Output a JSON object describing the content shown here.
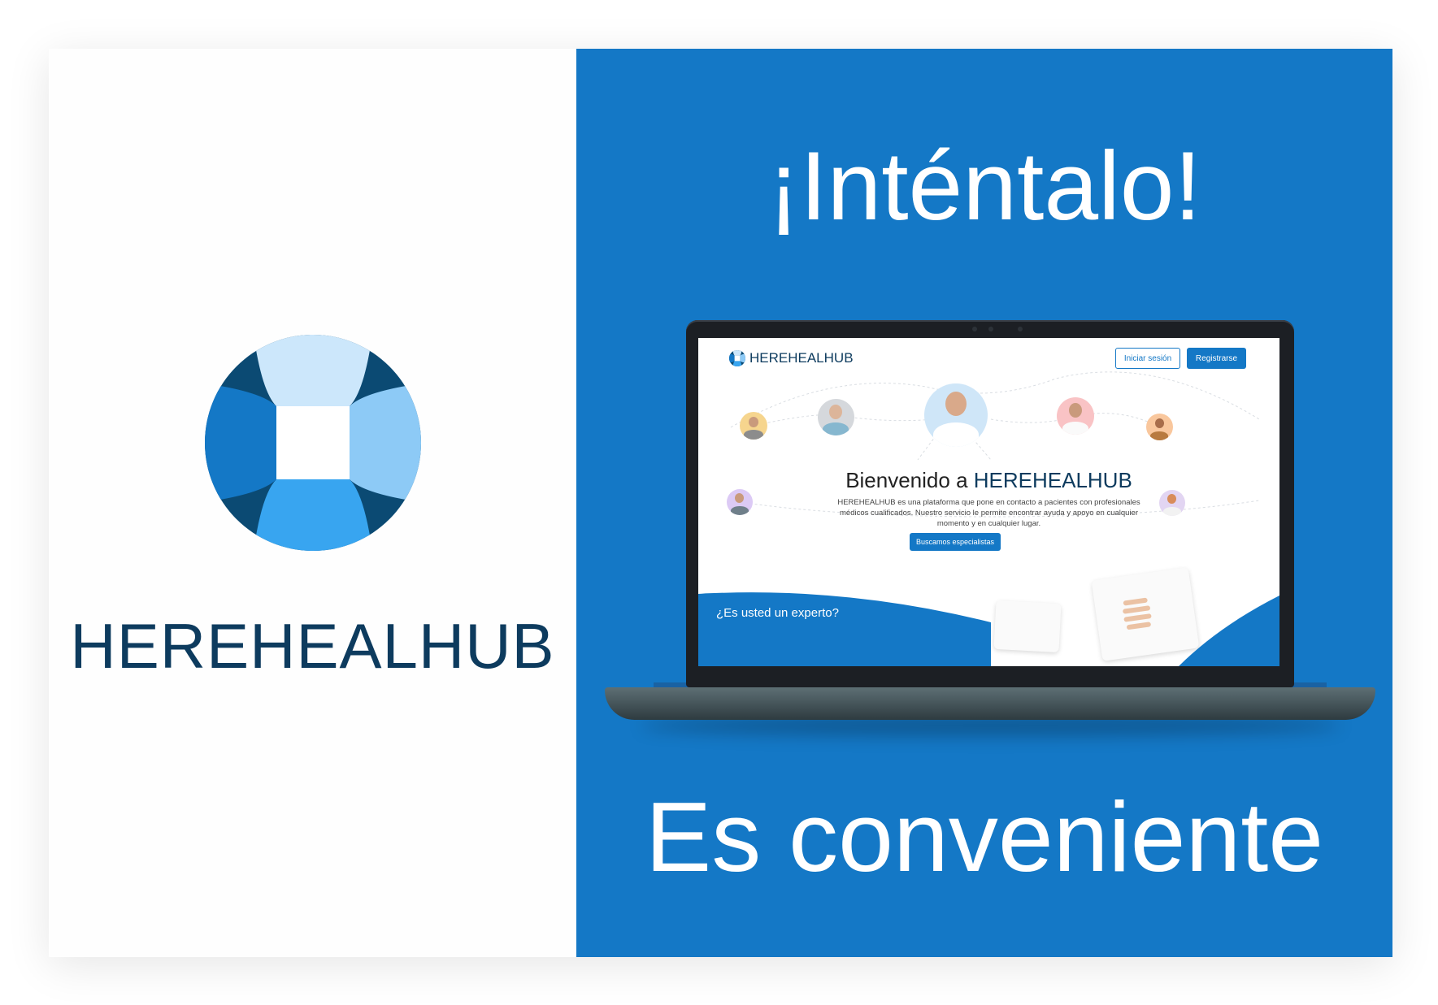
{
  "brand": {
    "name": "HEREHEALHUB"
  },
  "promo": {
    "headline": "¡Inténtalo!",
    "tagline": "Es conveniente"
  },
  "site": {
    "brand": "HEREHEALHUB",
    "nav": {
      "login_label": "Iniciar sesión",
      "register_label": "Registrarse"
    },
    "hero": {
      "welcome_prefix": "Bienvenido a ",
      "welcome_brand": "HEREHEALHUB",
      "description": "HEREHEALHUB es una plataforma que pone en contacto a pacientes con profesionales médicos cualificados. Nuestro servicio le permite encontrar ayuda y apoyo en cualquier momento y en cualquier lugar.",
      "cta_label": "Buscamos especialistas"
    },
    "expert_banner": "¿Es usted un experto?"
  },
  "colors": {
    "primary_blue": "#1478c6",
    "navy": "#0d3b5e",
    "logo_light": "#cce7fb",
    "logo_mid": "#8dcaf6",
    "logo_bright": "#38a5f0",
    "logo_dark": "#0b4a73"
  }
}
